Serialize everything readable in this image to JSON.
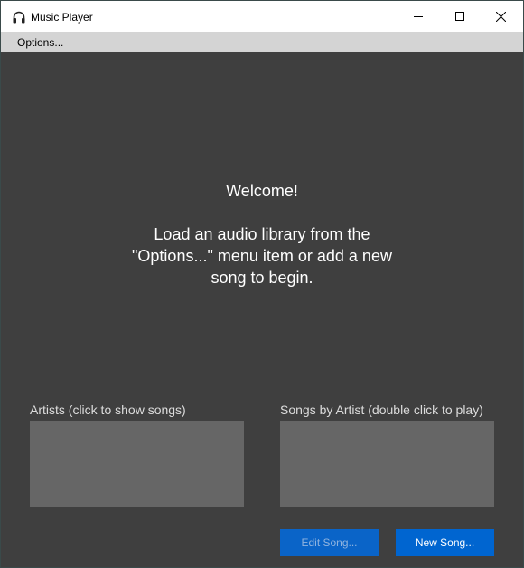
{
  "window": {
    "title": "Music Player",
    "icon": "headphones-icon",
    "controls": [
      "minimize-icon",
      "maximize-icon",
      "close-icon"
    ]
  },
  "menu": {
    "options_label": "Options..."
  },
  "welcome": {
    "heading": "Welcome!",
    "line1": "Load an audio library from the",
    "line2": "\"Options...\" menu item or add a new",
    "line3": "song to begin."
  },
  "artists": {
    "label": "Artists (click to show songs)",
    "items": []
  },
  "songs": {
    "label": "Songs by Artist (double click to play)",
    "items": []
  },
  "buttons": {
    "edit_song": "Edit Song...",
    "new_song": "New Song..."
  },
  "colors": {
    "background": "#3f3f3f",
    "listbox": "#666666",
    "accent": "#0065d0",
    "menubar": "#d4d4d4"
  }
}
